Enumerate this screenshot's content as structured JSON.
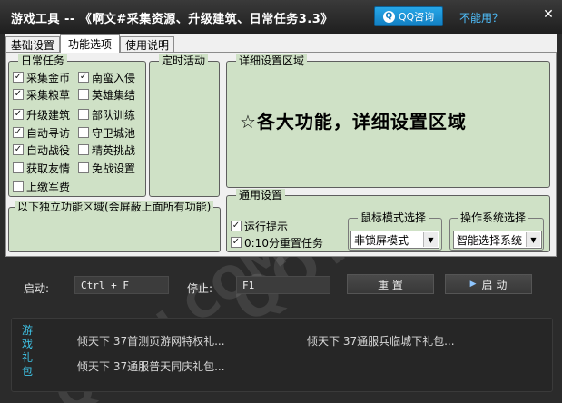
{
  "window": {
    "title": "游戏工具 -- 《啊文#采集资源、升级建筑、日常任务3.3》",
    "qq_button": "QQ咨询",
    "help_link": "不能用？",
    "close": "✕"
  },
  "tabs": [
    {
      "label": "基础设置",
      "active": false
    },
    {
      "label": "功能选项",
      "active": true
    },
    {
      "label": "使用说明",
      "active": false
    }
  ],
  "daily_tasks": {
    "title": "日常任务",
    "left": [
      {
        "label": "采集金币",
        "checked": true
      },
      {
        "label": "采集粮草",
        "checked": true
      },
      {
        "label": "升级建筑",
        "checked": true
      },
      {
        "label": "自动寻访",
        "checked": true
      },
      {
        "label": "自动战役",
        "checked": true
      },
      {
        "label": "获取友情",
        "checked": false
      },
      {
        "label": "上缴军费",
        "checked": false
      }
    ],
    "right": [
      {
        "label": "南蛮入侵",
        "checked": true
      },
      {
        "label": "英雄集结",
        "checked": false
      },
      {
        "label": "部队训练",
        "checked": false
      },
      {
        "label": "守卫城池",
        "checked": false
      },
      {
        "label": "精英挑战",
        "checked": false
      },
      {
        "label": "免战设置",
        "checked": false
      }
    ]
  },
  "timed_events": {
    "title": "定时活动"
  },
  "detail": {
    "title": "详细设置区域",
    "headline": "☆各大功能，详细设置区域"
  },
  "standalone": {
    "title": "以下独立功能区域(会屏蔽上面所有功能)"
  },
  "general": {
    "title": "通用设置",
    "options": [
      {
        "label": "运行提示",
        "checked": true
      },
      {
        "label": "0:10分重置任务",
        "checked": true
      }
    ],
    "mouse_mode": {
      "title": "鼠标模式选择",
      "value": "非锁屏模式"
    },
    "os_mode": {
      "title": "操作系统选择",
      "value": "智能选择系统"
    }
  },
  "controls": {
    "start_label": "启动:",
    "start_hotkey": "Ctrl + F",
    "stop_label": "停止:",
    "stop_hotkey": "F1",
    "reset_button": "重 置",
    "start_button": "启 动"
  },
  "gift": {
    "label": "游戏礼包",
    "links": [
      "倾天下 37首测页游网特权礼...",
      "倾天下 37通服兵临城下礼包...",
      "倾天下 37通服普天同庆礼包..."
    ]
  },
  "icons": {
    "qq": "qq-penguin-icon",
    "play": "play-icon",
    "dropdown": "chevron-down-icon"
  },
  "colors": {
    "group_bg": "#cfe1c6",
    "dark_bg": "#2b2b2b",
    "qq_blue": "#1a8fd6",
    "link_blue": "#4fc1ff",
    "gift_label": "#3fc3e6"
  }
}
